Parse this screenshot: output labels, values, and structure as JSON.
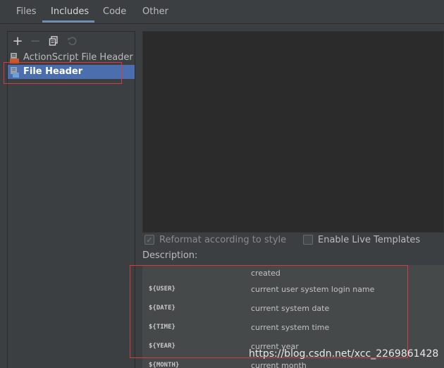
{
  "tabs": [
    {
      "label": "Files"
    },
    {
      "label": "Includes"
    },
    {
      "label": "Code"
    },
    {
      "label": "Other"
    }
  ],
  "active_tab": "Includes",
  "tree": {
    "items": [
      {
        "label": "ActionScript File Header",
        "icon": "actionscript-file-icon",
        "selected": false
      },
      {
        "label": "File Header",
        "icon": "file-template-icon",
        "selected": true
      }
    ]
  },
  "options": {
    "reformat_label": "Reformat according to style",
    "reformat_checked": true,
    "live_templates_label": "Enable Live Templates",
    "live_templates_checked": false
  },
  "description": {
    "label": "Description:",
    "partial_top": "created",
    "variables": [
      {
        "name": "${USER}",
        "desc": "current user system login name"
      },
      {
        "name": "${DATE}",
        "desc": "current system date"
      },
      {
        "name": "${TIME}",
        "desc": "current system time"
      },
      {
        "name": "${YEAR}",
        "desc": "current year"
      },
      {
        "name": "${MONTH}",
        "desc": "current month"
      }
    ]
  },
  "watermark": "https://blog.csdn.net/xcc_2269861428",
  "colors": {
    "selection": "#4b6eaf",
    "highlight_box": "#d83b3b",
    "tab_underline": "#6e8fb5"
  }
}
